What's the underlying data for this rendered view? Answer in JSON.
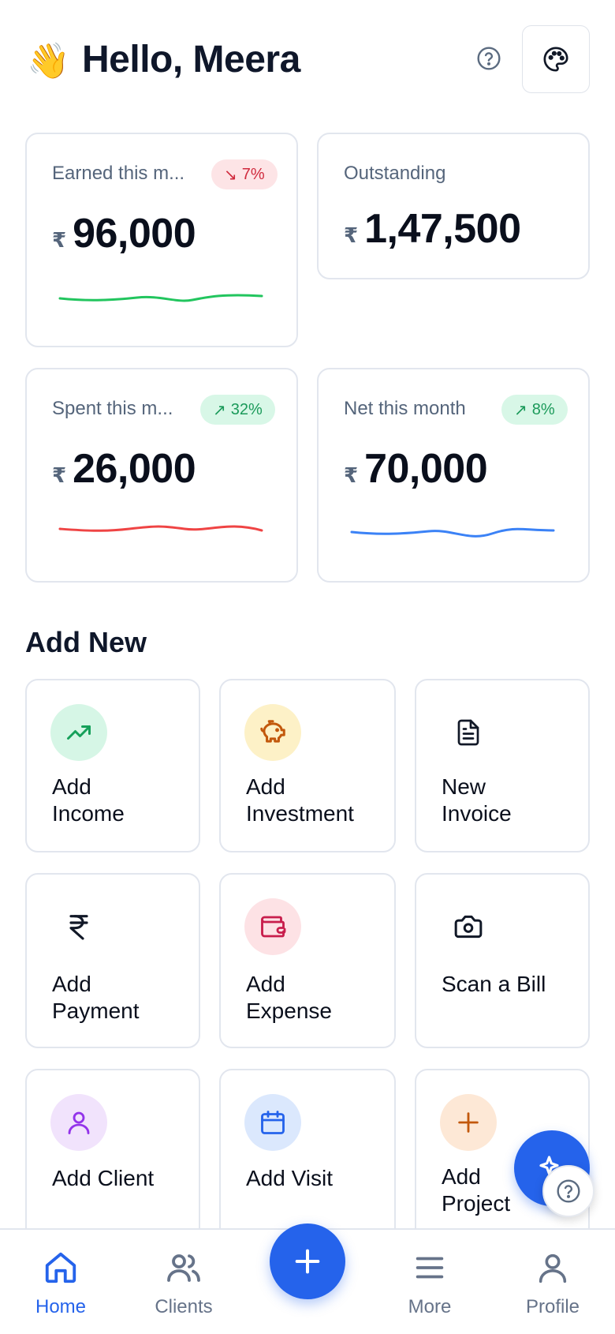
{
  "header": {
    "wave_emoji": "👋",
    "greeting": "Hello, Meera"
  },
  "stats": [
    {
      "label": "Earned this m...",
      "currency": "₹",
      "value": "96,000",
      "badge": {
        "arrow": "↘",
        "text": "7%",
        "direction": "down"
      },
      "spark_color": "#22c55e"
    },
    {
      "label": "Outstanding",
      "currency": "₹",
      "value": "1,47,500"
    },
    {
      "label": "Spent this m...",
      "currency": "₹",
      "value": "26,000",
      "badge": {
        "arrow": "↗",
        "text": "32%",
        "direction": "up"
      },
      "spark_color": "#ef4444"
    },
    {
      "label": "Net this month",
      "currency": "₹",
      "value": "70,000",
      "badge": {
        "arrow": "↗",
        "text": "8%",
        "direction": "up"
      },
      "spark_color": "#3b82f6"
    }
  ],
  "add_new": {
    "title": "Add New",
    "items": [
      {
        "line1": "Add",
        "line2": "Income",
        "icon": "trending-up-icon"
      },
      {
        "line1": "Add",
        "line2": "Investment",
        "icon": "piggy-bank-icon"
      },
      {
        "line1": "New",
        "line2": "Invoice",
        "icon": "file-text-icon"
      },
      {
        "line1": "Add",
        "line2": "Payment",
        "icon": "rupee-icon"
      },
      {
        "line1": "Add",
        "line2": "Expense",
        "icon": "wallet-icon"
      },
      {
        "line1": "",
        "line2": "Scan a Bill",
        "icon": "camera-icon"
      },
      {
        "line1": "",
        "line2": "Add Client",
        "icon": "user-icon"
      },
      {
        "line1": "",
        "line2": "Add Visit",
        "icon": "calendar-icon"
      },
      {
        "line1": "Add",
        "line2": "Project",
        "icon": "plus-icon"
      }
    ]
  },
  "nav": {
    "home": "Home",
    "clients": "Clients",
    "more": "More",
    "profile": "Profile"
  },
  "colors": {
    "accent": "#2563eb",
    "up": "#1b9a5a",
    "down": "#d02a3d"
  }
}
